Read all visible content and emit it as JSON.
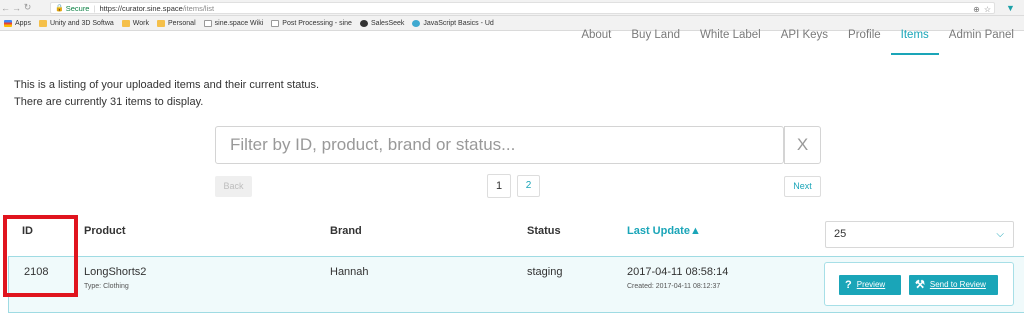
{
  "browser": {
    "secure_label": "Secure",
    "url_host": "https://curator.sine.space",
    "url_path": "/items/list",
    "bookmarks": [
      {
        "label": "Apps",
        "icon": "apps-icon"
      },
      {
        "label": "Unity and 3D Softwa",
        "icon": "folder-icon"
      },
      {
        "label": "Work",
        "icon": "folder-icon"
      },
      {
        "label": "Personal",
        "icon": "folder-icon"
      },
      {
        "label": "sine.space Wiki",
        "icon": "page-icon"
      },
      {
        "label": "Post Processing - sine",
        "icon": "page-icon"
      },
      {
        "label": "SalesSeek",
        "icon": "salesseek-icon"
      },
      {
        "label": "JavaScript Basics - Ud",
        "icon": "udemy-icon"
      }
    ]
  },
  "nav": {
    "items": [
      {
        "label": "About"
      },
      {
        "label": "Buy Land"
      },
      {
        "label": "White Label"
      },
      {
        "label": "API Keys"
      },
      {
        "label": "Profile"
      },
      {
        "label": "Items"
      },
      {
        "label": "Admin Panel"
      }
    ],
    "active": "Items"
  },
  "intro": {
    "line1": "This is a listing of your uploaded items and their current status.",
    "line2": "There are currently 31 items to display."
  },
  "filter": {
    "placeholder": "Filter by ID, product, brand or status...",
    "clear_label": "X"
  },
  "pagination": {
    "back_label": "Back",
    "pages": [
      "1",
      "2"
    ],
    "current_page": "1",
    "next_label": "Next"
  },
  "table": {
    "headers": {
      "id": "ID",
      "product": "Product",
      "brand": "Brand",
      "status": "Status",
      "last_update": "Last Update▲"
    },
    "per_page": "25",
    "rows": [
      {
        "id": "2108",
        "product": "LongShorts2",
        "type": "Type: Clothing",
        "brand": "Hannah",
        "status": "staging",
        "last_update": "2017-04-11 08:58:14",
        "created": "Created: 2017-04-11 08:12:37",
        "preview_label": "Preview",
        "review_label": "Send to Review"
      }
    ]
  },
  "colors": {
    "accent": "#1aa5b8",
    "highlight": "#e0141e",
    "row_bg": "#f0fafb"
  }
}
